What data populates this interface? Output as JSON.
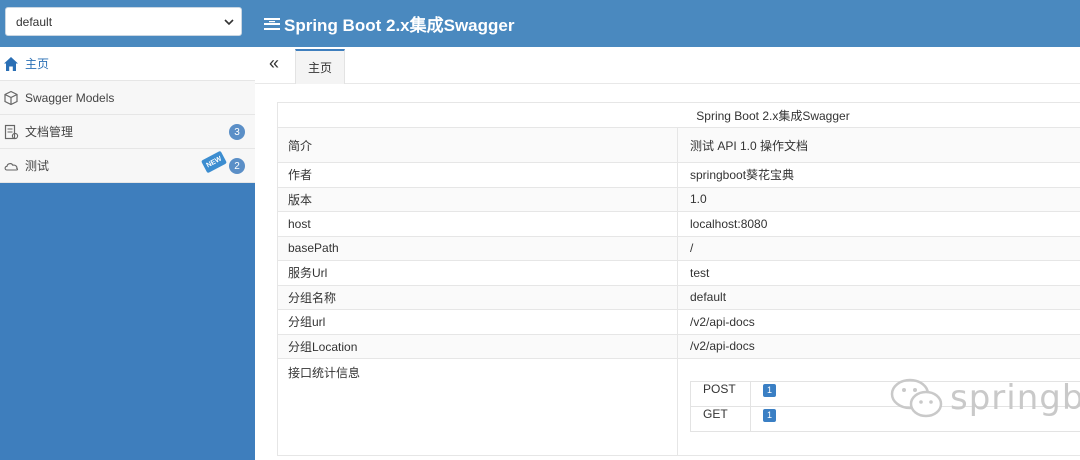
{
  "header": {
    "group_select_value": "default",
    "title": "Spring Boot 2.x集成Swagger"
  },
  "sidebar": {
    "items": [
      {
        "label": "主页",
        "icon": "home-icon"
      },
      {
        "label": "Swagger Models",
        "icon": "cube-icon"
      },
      {
        "label": "文档管理",
        "icon": "document-icon",
        "badge": "3"
      },
      {
        "label": "测试",
        "icon": "cloud-icon",
        "badge": "2",
        "tag": "NEW"
      }
    ]
  },
  "tabs": {
    "collapse_symbol": "«",
    "active_label": "主页"
  },
  "info": {
    "title": "Spring Boot 2.x集成Swagger",
    "rows": [
      {
        "key": "简介",
        "value": "测试 API 1.0 操作文档"
      },
      {
        "key": "作者",
        "value": "springboot葵花宝典"
      },
      {
        "key": "版本",
        "value": "1.0"
      },
      {
        "key": "host",
        "value": "localhost:8080"
      },
      {
        "key": "basePath",
        "value": "/"
      },
      {
        "key": "服务Url",
        "value": "test"
      },
      {
        "key": "分组名称",
        "value": "default"
      },
      {
        "key": "分组url",
        "value": "/v2/api-docs"
      },
      {
        "key": "分组Location",
        "value": "/v2/api-docs"
      }
    ],
    "stats_label": "接口统计信息",
    "stats": [
      {
        "method": "POST",
        "count": "1"
      },
      {
        "method": "GET",
        "count": "1"
      }
    ]
  },
  "watermark": {
    "text": "springbo"
  },
  "colors": {
    "header_bg": "#4a89bf",
    "sidebar_bg": "#3e7ebd",
    "badge": "#5b8fc7",
    "count": "#3a7fc4"
  }
}
